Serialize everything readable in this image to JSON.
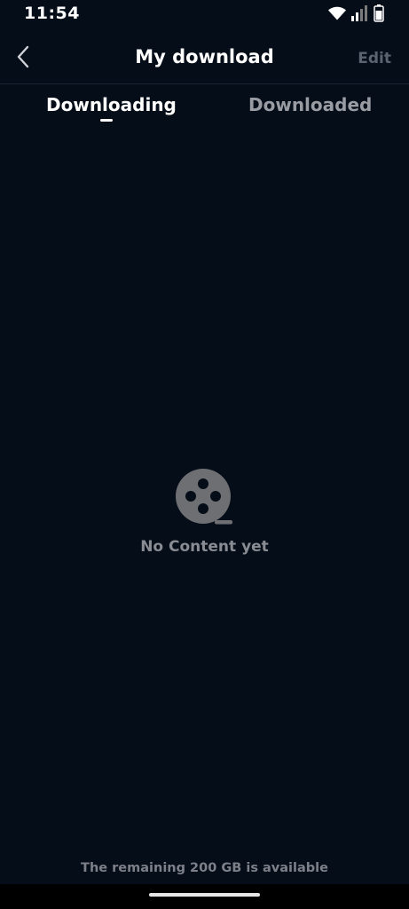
{
  "status_bar": {
    "time": "11:54",
    "icons": [
      "wifi-icon",
      "signal-icon",
      "battery-icon"
    ]
  },
  "header": {
    "title": "My download",
    "back_icon": "chevron-left-icon",
    "edit_label": "Edit"
  },
  "tabs": [
    {
      "label": "Downloading",
      "active": true
    },
    {
      "label": "Downloaded",
      "active": false
    }
  ],
  "empty_state": {
    "icon": "film-reel-icon",
    "message": "No Content yet"
  },
  "storage": {
    "text": "The remaining 200 GB is available"
  },
  "colors": {
    "background": "#050d18",
    "text_primary": "#ffffff",
    "text_muted": "#8a8c93",
    "edit_disabled": "#5b6270"
  }
}
